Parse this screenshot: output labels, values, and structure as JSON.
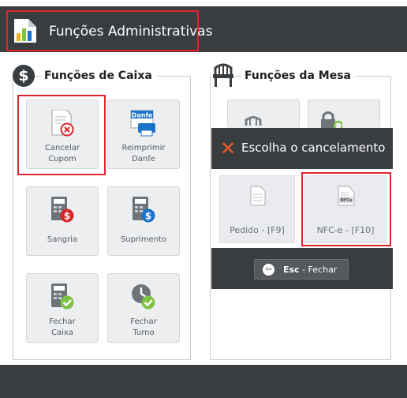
{
  "header": {
    "title": "Funções Administrativas"
  },
  "caixa": {
    "title": "Funções de Caixa",
    "icon_symbol": "$",
    "tiles": [
      {
        "label": "Cancelar\nCupom",
        "icon": "cancel-receipt-icon"
      },
      {
        "label": "Reimprimir\nDanfe",
        "icon": "danfe-printer-icon",
        "badge": "Danfe"
      },
      {
        "label": "Sangria",
        "icon": "calculator-withdraw-icon"
      },
      {
        "label": "Suprimento",
        "icon": "calculator-supply-icon"
      },
      {
        "label": "Fechar\nCaixa",
        "icon": "calculator-close-icon"
      },
      {
        "label": "Fechar\nTurno",
        "icon": "clock-close-icon"
      }
    ]
  },
  "mesa": {
    "title": "Funções da Mesa",
    "icon": "table-icon"
  },
  "popup": {
    "title": "Escolha o cancelamento",
    "options": [
      {
        "label": "Pedido - [F9]",
        "icon": "document-icon"
      },
      {
        "label": "NFC-e - [F10]",
        "icon": "nfce-document-icon",
        "badge": "NFCe"
      }
    ],
    "close_key": "Esc",
    "close_label": " - Fechar"
  },
  "colors": {
    "dark": "#3a3d40",
    "highlight": "#e0242e",
    "red": "#d9262b",
    "blue": "#1a73c8",
    "green": "#7dc242",
    "orange": "#f15a24"
  }
}
